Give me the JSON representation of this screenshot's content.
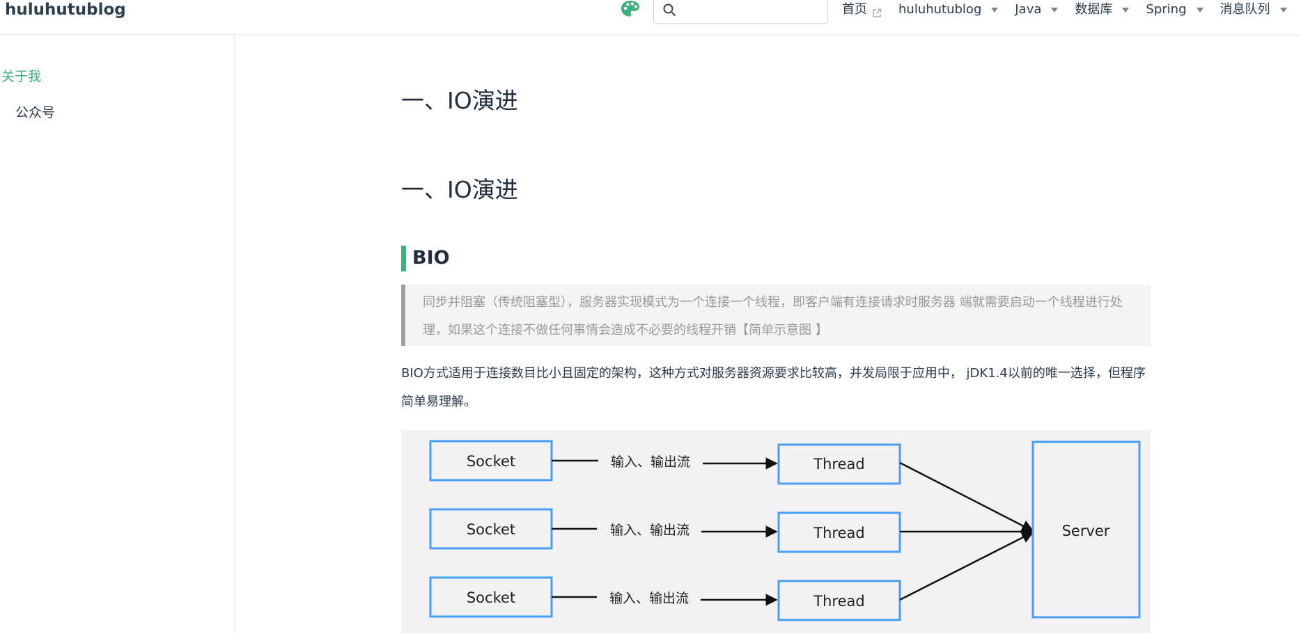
{
  "navbar": {
    "site_name": "huluhutublog",
    "search": {
      "value": "",
      "placeholder": ""
    },
    "links": [
      {
        "label": "首页",
        "external": true
      },
      {
        "label": "huluhutublog",
        "dropdown": true
      },
      {
        "label": "Java",
        "dropdown": true
      },
      {
        "label": "数据库",
        "dropdown": true
      },
      {
        "label": "Spring",
        "dropdown": true
      },
      {
        "label": "消息队列",
        "dropdown": true
      }
    ]
  },
  "sidebar": {
    "items": [
      {
        "label": "关于我",
        "active": true
      },
      {
        "label": "公众号",
        "active": false
      }
    ]
  },
  "content": {
    "page_title": "一、IO演进",
    "section_title": "一、IO演进",
    "subsection_title": "BIO",
    "quote": "同步并阻塞（传统阻塞型），服务器实现模式为一个连接一个线程，即客户端有连接请求时服务器 端就需要启动一个线程进行处理，如果这个连接不做任何事情会造成不必要的线程开销【简单示意图 】",
    "paragraph": "BIO方式适用于连接数目比小且固定的架构，这种方式对服务器资源要求比较高，并发局限于应用中， jDK1.4以前的唯一选择，但程序简单易理解。",
    "diagram": {
      "rows": [
        {
          "socket": "Socket",
          "flow": "输入、输出流",
          "thread": "Thread"
        },
        {
          "socket": "Socket",
          "flow": "输入、输出流",
          "thread": "Thread"
        },
        {
          "socket": "Socket",
          "flow": "输入、输出流",
          "thread": "Thread"
        }
      ],
      "server": "Server"
    }
  },
  "colors": {
    "accent": "#3eaf7c",
    "diagram_box_border": "#4a9ff5",
    "quote_border": "#a0a0a0"
  }
}
